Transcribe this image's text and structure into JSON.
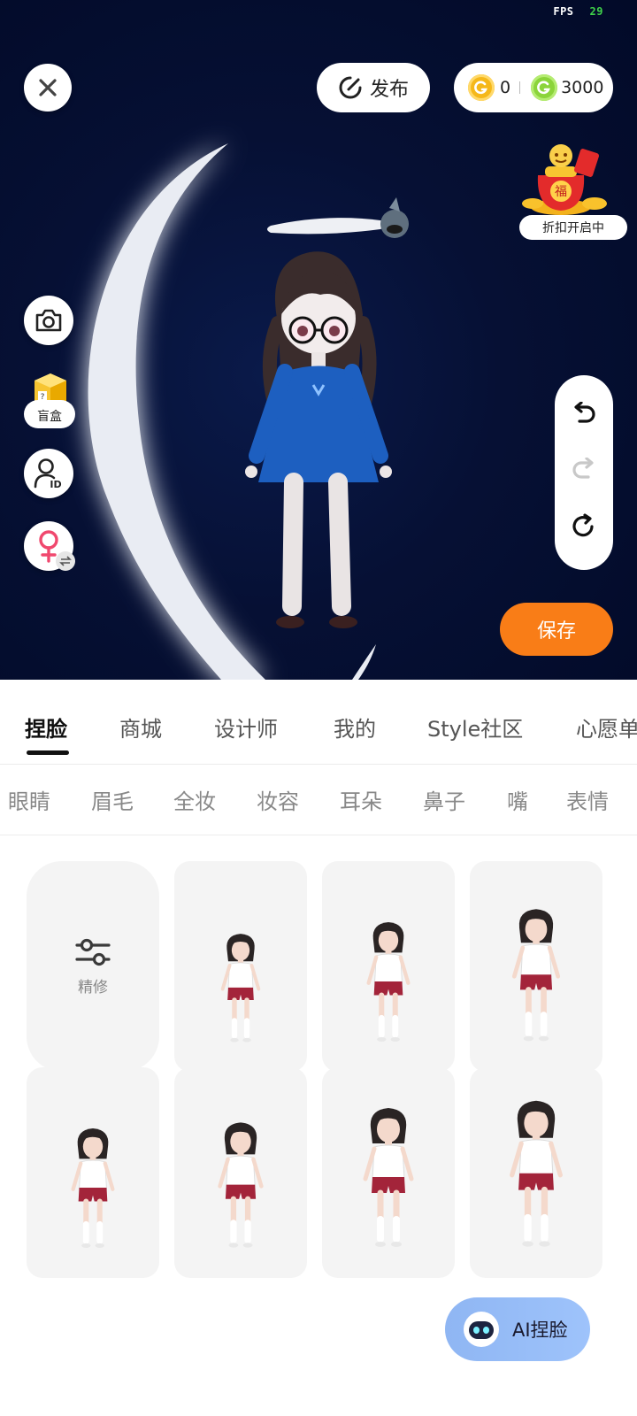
{
  "status": {
    "fps_label": "FPS",
    "fps_value": "29"
  },
  "top_bar": {
    "publish_label": "发布",
    "coin_gold_value": "0",
    "coin_green_value": "3000"
  },
  "promo": {
    "label": "折扣开启中",
    "icon": "fortune-bag-icon"
  },
  "side_tools": {
    "blindbox_label": "盲盒"
  },
  "save_label": "保存",
  "main_tabs": [
    {
      "label": "捏脸",
      "active": true
    },
    {
      "label": "商城"
    },
    {
      "label": "设计师"
    },
    {
      "label": "我的"
    },
    {
      "label": "Style社区"
    },
    {
      "label": "心愿单"
    }
  ],
  "sub_tabs": [
    {
      "label": "眼睛"
    },
    {
      "label": "眉毛"
    },
    {
      "label": "全妆"
    },
    {
      "label": "妆容"
    },
    {
      "label": "耳朵"
    },
    {
      "label": "鼻子"
    },
    {
      "label": "嘴"
    },
    {
      "label": "表情"
    }
  ],
  "refine_label": "精修",
  "ai_button_label": "AI捏脸",
  "colors": {
    "scene_bg": "#061034",
    "save_orange": "#f97d17",
    "ai_blue": "#9ec3fb",
    "card_bg": "#f4f4f4"
  }
}
